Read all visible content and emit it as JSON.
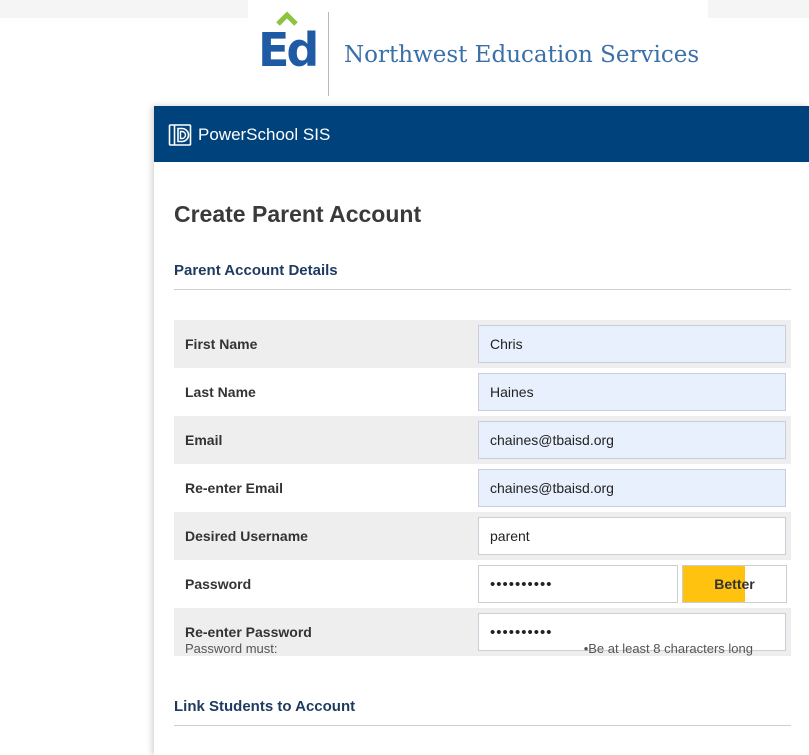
{
  "header": {
    "logo_mark": "Ed",
    "org_name": "Northwest Education Services"
  },
  "app": {
    "title": "PowerSchool SIS",
    "icon": "powerschool-logo-icon"
  },
  "page": {
    "title": "Create Parent Account"
  },
  "sections": {
    "account_details": "Parent Account Details",
    "link_students": "Link Students to Account"
  },
  "form": {
    "fields": [
      {
        "label": "First Name",
        "value": "Chris"
      },
      {
        "label": "Last Name",
        "value": "Haines"
      },
      {
        "label": "Email",
        "value": "chaines@tbaisd.org"
      },
      {
        "label": "Re-enter Email",
        "value": "chaines@tbaisd.org"
      },
      {
        "label": "Desired Username",
        "value": "parent"
      },
      {
        "label": "Password",
        "value": "••••••••••"
      },
      {
        "label": "Re-enter Password",
        "value": "••••••••••"
      }
    ],
    "password_strength": {
      "label": "Better",
      "level": 0.6,
      "color": "#ffc20e"
    },
    "password_rules_label": "Password must:",
    "password_rules": [
      "•Be at least 8 characters long"
    ]
  },
  "colors": {
    "banner": "#00427c",
    "autofill": "#e8f0fe",
    "row_shade": "#eeeeee",
    "section_title": "#1e3a5f"
  }
}
